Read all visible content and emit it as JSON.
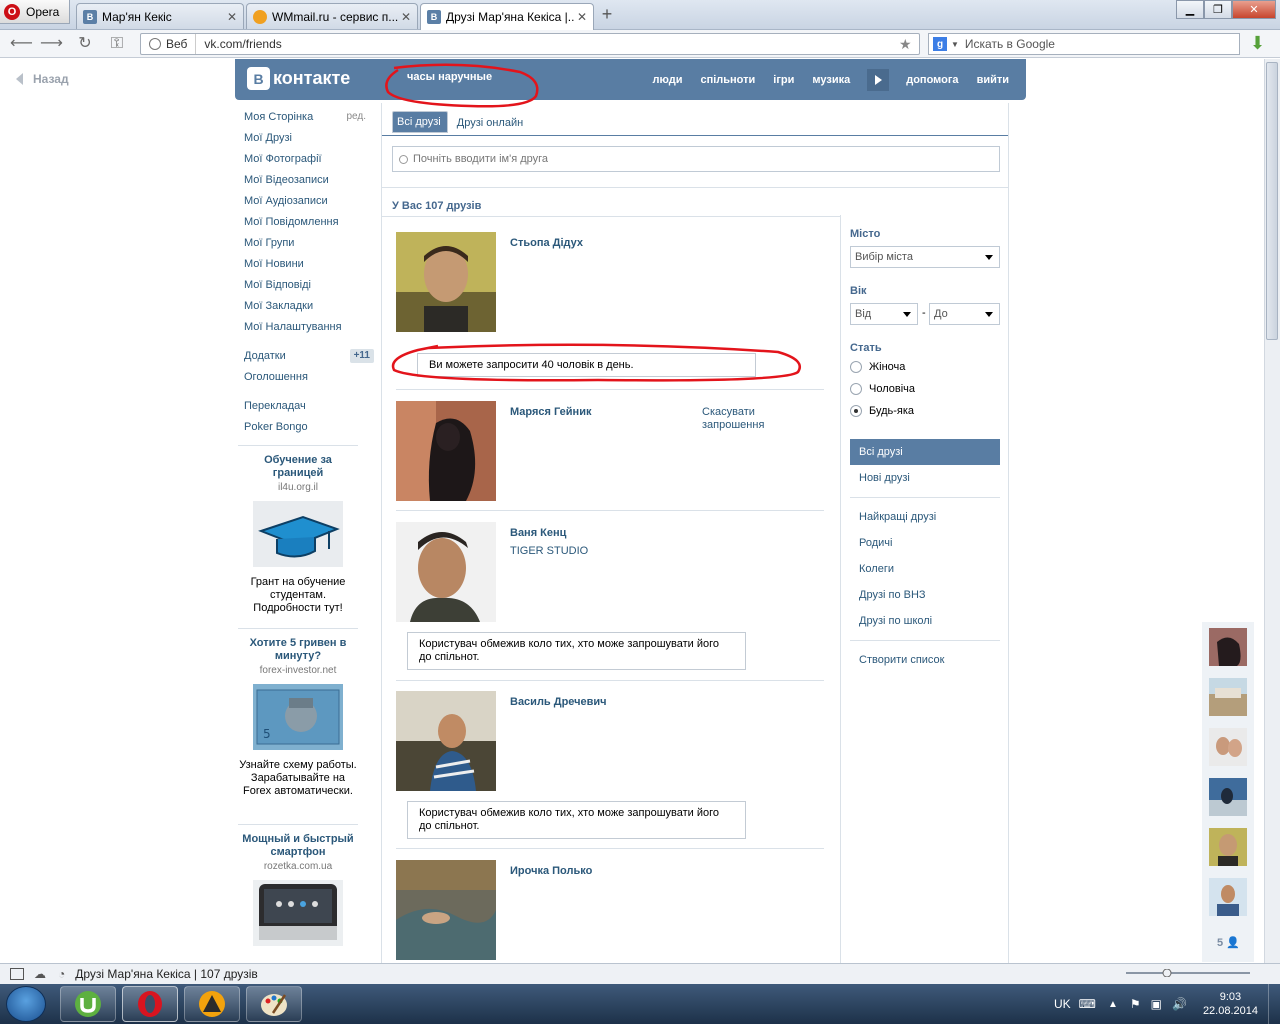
{
  "browser": {
    "menu_label": "Opera",
    "tabs": [
      {
        "title": "Мар'ян Кекіс",
        "active": false
      },
      {
        "title": "WMmail.ru - сервис п...",
        "active": false
      },
      {
        "title": "Друзі Мар'яна Кекіса |...",
        "active": true
      }
    ],
    "address": {
      "scheme_label": "Веб",
      "url": "vk.com/friends"
    },
    "search_placeholder": "Искать в Google",
    "status_text": "Друзі Мар'яна Кекіса | 107 друзів"
  },
  "page": {
    "back_label": "Назад",
    "logo_text": "контакте",
    "header_search_text": "часы наручные",
    "header_nav": [
      "люди",
      "спільноти",
      "ігри",
      "музика",
      "допомога",
      "вийти"
    ]
  },
  "left_menu": {
    "items": [
      {
        "label": "Моя Сторінка",
        "extra": "ред."
      },
      {
        "label": "Мої Друзі"
      },
      {
        "label": "Мої Фотографії"
      },
      {
        "label": "Мої Відеозаписи"
      },
      {
        "label": "Мої Аудіозаписи"
      },
      {
        "label": "Мої Повідомлення"
      },
      {
        "label": "Мої Групи"
      },
      {
        "label": "Мої Новини"
      },
      {
        "label": "Мої Відповіді"
      },
      {
        "label": "Мої Закладки"
      },
      {
        "label": "Мої Налаштування"
      }
    ],
    "items2": [
      {
        "label": "Додатки",
        "badge": "+11"
      },
      {
        "label": "Оголошення"
      }
    ],
    "items3": [
      {
        "label": "Перекладач"
      },
      {
        "label": "Poker Bongo"
      }
    ]
  },
  "ads": [
    {
      "title": "Обучение за границей",
      "domain": "il4u.org.il",
      "text": "Грант на обучение студентам. Подробности тут!"
    },
    {
      "title": "Хотите 5 гривен в минуту?",
      "domain": "forex-investor.net",
      "text": "Узнайте схему работы. Зарабатывайте на Forex автоматически."
    },
    {
      "title": "Мощный и быстрый смартфон",
      "domain": "rozetka.com.ua",
      "text": ""
    }
  ],
  "friends_page": {
    "tabs": [
      "Всі друзі",
      "Друзі онлайн"
    ],
    "search_placeholder": "Почніть вводити ім'я друга",
    "count_text": "У Вас 107 друзів",
    "friends": [
      {
        "name": "Стьопа Дідух",
        "sub": "",
        "action": "",
        "notice": "Ви можете запросити 40 чоловік в день."
      },
      {
        "name": "Маряся Гейник",
        "sub": "",
        "action": "Скасувати запрошення",
        "notice": ""
      },
      {
        "name": "Ваня Кенц",
        "sub": "TIGER STUDIO",
        "action": "",
        "notice": "Користувач обмежив коло тих, хто може запрошувати його до спільнот."
      },
      {
        "name": "Василь Дречевич",
        "sub": "",
        "action": "",
        "notice": "Користувач обмежив коло тих, хто може запрошувати його до спільнот."
      },
      {
        "name": "Ирочка Полько",
        "sub": "",
        "action": "",
        "notice": ""
      }
    ]
  },
  "filter": {
    "city_label": "Місто",
    "city_value": "Вибір міста",
    "age_label": "Вік",
    "age_from": "Від",
    "age_dash": "-",
    "age_to": "До",
    "sex_label": "Стать",
    "sex_options": [
      "Жіноча",
      "Чоловіча",
      "Будь-яка"
    ],
    "sex_selected": "Будь-яка",
    "lists_1": [
      "Всі друзі",
      "Нові друзі"
    ],
    "lists_2": [
      "Найкращі друзі",
      "Родичі",
      "Колеги",
      "Друзі по ВНЗ",
      "Друзі по школі"
    ],
    "create_list": "Створити список"
  },
  "online_strip": {
    "count": "5"
  },
  "taskbar": {
    "lang": "UK",
    "time": "9:03",
    "date": "22.08.2014"
  },
  "colors": {
    "vk_blue": "#597da3",
    "link": "#2b587a",
    "annotation_red": "#e3141b"
  }
}
